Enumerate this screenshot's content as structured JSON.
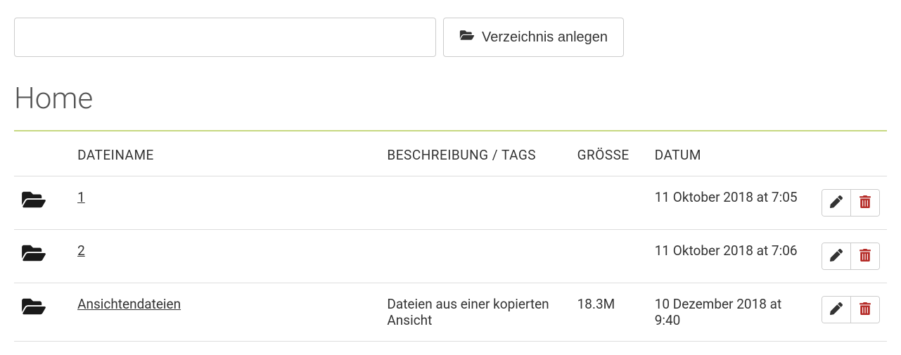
{
  "toolbar": {
    "directory_input_value": "",
    "create_directory_label": "Verzeichnis anlegen"
  },
  "page_title": "Home",
  "table": {
    "headers": {
      "filename": "DATEINAME",
      "description": "BESCHREIBUNG / TAGS",
      "size": "GRÖSSE",
      "date": "DATUM"
    },
    "rows": [
      {
        "name": "1",
        "description": "",
        "size": "",
        "date": "11 Oktober 2018 at 7:05"
      },
      {
        "name": "2",
        "description": "",
        "size": "",
        "date": "11 Oktober 2018 at 7:06"
      },
      {
        "name": "Ansichtendateien",
        "description": "Dateien aus einer kopierten Ansicht",
        "size": "18.3M",
        "date": "10 Dezember 2018 at 9:40"
      }
    ]
  }
}
